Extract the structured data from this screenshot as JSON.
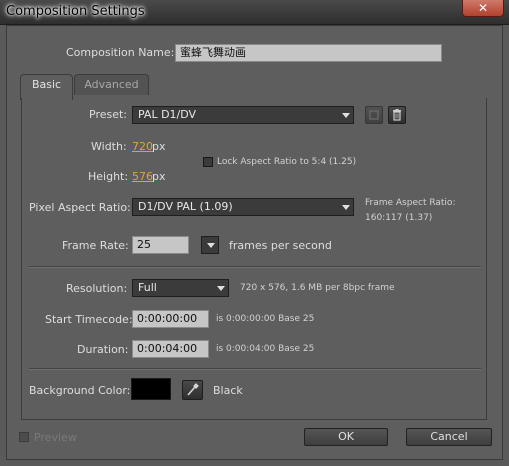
{
  "window": {
    "title": "Composition Settings",
    "close_glyph": "✕"
  },
  "comp_name": {
    "label": "Composition Name:",
    "value": "蜜蜂飞舞动画"
  },
  "tabs": [
    {
      "label": "Basic"
    },
    {
      "label": "Advanced"
    }
  ],
  "preset": {
    "label": "Preset:",
    "value": "PAL D1/DV"
  },
  "width": {
    "label": "Width:",
    "value": "720",
    "unit": "px"
  },
  "height": {
    "label": "Height:",
    "value": "576",
    "unit": "px"
  },
  "lock_aspect": {
    "label": "Lock Aspect Ratio to 5:4 (1.25)",
    "checked": false
  },
  "pixel_aspect": {
    "label": "Pixel Aspect Ratio:",
    "value": "D1/DV PAL (1.09)"
  },
  "frame_aspect": {
    "label": "Frame Aspect Ratio:",
    "value": "160:117 (1.37)"
  },
  "frame_rate": {
    "label": "Frame Rate:",
    "value": "25",
    "unit": "frames per second"
  },
  "resolution": {
    "label": "Resolution:",
    "value": "Full",
    "info": "720 x 576, 1.6 MB per 8bpc frame"
  },
  "start_timecode": {
    "label": "Start Timecode:",
    "value": "0:00:00:00",
    "info": "is 0:00:00:00  Base 25"
  },
  "duration": {
    "label": "Duration:",
    "value": "0:00:04:00",
    "info": "is 0:00:04:00  Base 25"
  },
  "background": {
    "label": "Background Color:",
    "color": "#000000",
    "name": "Black"
  },
  "footer": {
    "preview_label": "Preview",
    "ok_label": "OK",
    "cancel_label": "Cancel"
  },
  "colors": {
    "accent_value": "#e0a23e",
    "dialog_bg": "#5e5e5e",
    "field_bg": "#3b3b3b"
  }
}
